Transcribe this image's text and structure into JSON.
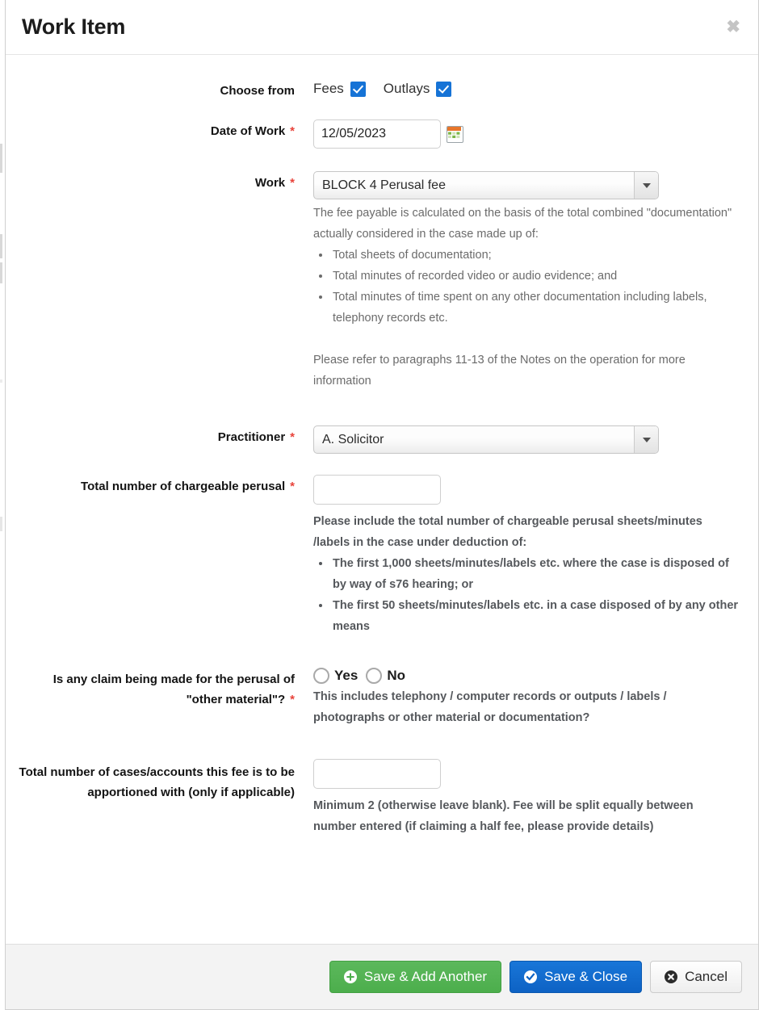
{
  "modal": {
    "title": "Work Item",
    "close_label": "✖"
  },
  "form": {
    "choose_from": {
      "label": "Choose from",
      "options": [
        {
          "label": "Fees",
          "checked": true
        },
        {
          "label": "Outlays",
          "checked": true
        }
      ]
    },
    "date_of_work": {
      "label": "Date of Work",
      "required": "*",
      "value": "12/05/2023",
      "calendar_icon": "calendar-icon"
    },
    "work": {
      "label": "Work",
      "required": "*",
      "selected": "BLOCK 4 Perusal fee",
      "help_intro": "The fee payable is calculated on the basis of the total combined \"documentation\" actually considered in the case made up of:",
      "help_bullets": [
        "Total sheets of documentation;",
        "Total minutes of recorded video or audio evidence; and",
        "Total minutes of time spent on any other documentation including labels, telephony records etc."
      ],
      "help_footer": "Please refer to paragraphs 11-13 of the Notes on the operation for more information"
    },
    "practitioner": {
      "label": "Practitioner",
      "required": "*",
      "selected": "A. Solicitor"
    },
    "total_chargeable_perusal": {
      "label": "Total number of chargeable perusal",
      "required": "*",
      "value": "",
      "help_intro": "Please include the total number of chargeable perusal sheets/minutes /labels in the case under deduction of:",
      "help_bullets": [
        "The first 1,000 sheets/minutes/labels etc. where the case is disposed of by way of s76 hearing; or",
        "The first 50 sheets/minutes/labels etc. in a case disposed of by any other means"
      ]
    },
    "other_material_claim": {
      "label": "Is any claim being made for the perusal of \"other material\"?",
      "required": "*",
      "options": [
        {
          "label": "Yes",
          "selected": false
        },
        {
          "label": "No",
          "selected": false
        }
      ],
      "help": "This includes telephony / computer records or outputs / labels / photographs or other material or documentation?"
    },
    "apportioned_cases": {
      "label": "Total number of cases/accounts this fee is to be apportioned with (only if applicable)",
      "value": "",
      "help": "Minimum 2 (otherwise leave blank). Fee will be split equally between number entered (if claiming a half fee, please provide details)"
    }
  },
  "footer": {
    "save_add_another": "Save & Add Another",
    "save_close": "Save & Close",
    "cancel": "Cancel"
  },
  "colors": {
    "required_asterisk": "#e8433a",
    "checkbox_blue": "#1673d6",
    "btn_green": "#5cb85c",
    "btn_blue": "#0d62c4",
    "help_text": "#6b6b6b"
  }
}
